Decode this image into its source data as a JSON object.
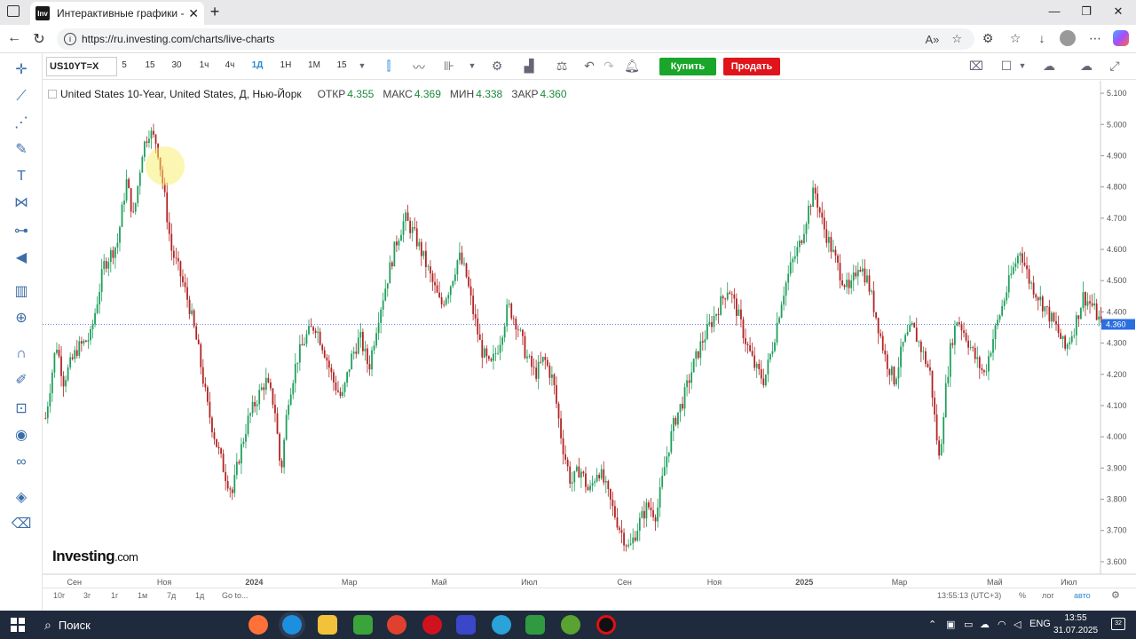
{
  "browser": {
    "tab_title": "Интерактивные графики - Invest",
    "tab_favicon": "Inv",
    "url": "https://ru.investing.com/charts/live-charts"
  },
  "toolbar": {
    "symbol": "US10YT=X",
    "timeframes": [
      "5",
      "15",
      "30",
      "1ч",
      "4ч",
      "1Д",
      "1Н",
      "1М",
      "15"
    ],
    "active_timeframe": "1Д",
    "buy_label": "Купить",
    "sell_label": "Продать"
  },
  "legend": {
    "name": "United States 10-Year, United States, Д, Нью-Йорк",
    "open_label": "ОТКР",
    "open": "4.355",
    "high_label": "МАКС",
    "high": "4.369",
    "low_label": "МИН",
    "low": "4.338",
    "close_label": "ЗАКР",
    "close": "4.360",
    "value_color": "#1b8b3a"
  },
  "chart_data": {
    "type": "candlestick",
    "y_ticks": [
      "5.100",
      "5.000",
      "4.900",
      "4.800",
      "4.700",
      "4.600",
      "4.500",
      "4.400",
      "4.300",
      "4.200",
      "4.100",
      "4.000",
      "3.900",
      "3.800",
      "3.700",
      "3.600"
    ],
    "ylim": [
      3.56,
      5.14
    ],
    "x_ticks": [
      "Сен",
      "Ноя",
      "2024",
      "Мар",
      "Май",
      "Июл",
      "Сен",
      "Ноя",
      "2025",
      "Мар",
      "Май",
      "Июл"
    ],
    "x_tick_values": [
      0.03,
      0.115,
      0.2,
      0.29,
      0.375,
      0.46,
      0.55,
      0.635,
      0.72,
      0.81,
      0.9,
      0.97
    ],
    "last_price": "4.360",
    "last_price_value": 4.36,
    "up_color": "#1e9e5a",
    "down_color": "#b22222",
    "path": [
      [
        0.0,
        4.06
      ],
      [
        0.012,
        4.3
      ],
      [
        0.02,
        4.18
      ],
      [
        0.035,
        4.28
      ],
      [
        0.05,
        4.32
      ],
      [
        0.065,
        4.55
      ],
      [
        0.08,
        4.62
      ],
      [
        0.09,
        4.82
      ],
      [
        0.098,
        4.7
      ],
      [
        0.108,
        4.92
      ],
      [
        0.115,
        4.98
      ],
      [
        0.124,
        4.94
      ],
      [
        0.132,
        4.78
      ],
      [
        0.14,
        4.6
      ],
      [
        0.15,
        4.52
      ],
      [
        0.16,
        4.42
      ],
      [
        0.17,
        4.28
      ],
      [
        0.18,
        4.1
      ],
      [
        0.19,
        3.98
      ],
      [
        0.2,
        3.88
      ],
      [
        0.208,
        3.82
      ],
      [
        0.215,
        3.93
      ],
      [
        0.225,
        4.05
      ],
      [
        0.235,
        4.12
      ],
      [
        0.245,
        4.18
      ],
      [
        0.255,
        4.1
      ],
      [
        0.262,
        3.88
      ],
      [
        0.27,
        4.12
      ],
      [
        0.28,
        4.25
      ],
      [
        0.29,
        4.32
      ],
      [
        0.3,
        4.36
      ],
      [
        0.31,
        4.28
      ],
      [
        0.32,
        4.18
      ],
      [
        0.33,
        4.12
      ],
      [
        0.34,
        4.25
      ],
      [
        0.35,
        4.32
      ],
      [
        0.36,
        4.22
      ],
      [
        0.37,
        4.38
      ],
      [
        0.38,
        4.5
      ],
      [
        0.39,
        4.62
      ],
      [
        0.4,
        4.7
      ],
      [
        0.41,
        4.65
      ],
      [
        0.42,
        4.58
      ],
      [
        0.43,
        4.5
      ],
      [
        0.44,
        4.42
      ],
      [
        0.45,
        4.48
      ],
      [
        0.46,
        4.58
      ],
      [
        0.468,
        4.52
      ],
      [
        0.476,
        4.4
      ],
      [
        0.485,
        4.28
      ],
      [
        0.495,
        4.22
      ],
      [
        0.505,
        4.3
      ],
      [
        0.515,
        4.42
      ],
      [
        0.525,
        4.36
      ],
      [
        0.535,
        4.26
      ],
      [
        0.545,
        4.2
      ],
      [
        0.555,
        4.25
      ],
      [
        0.565,
        4.18
      ],
      [
        0.575,
        3.98
      ],
      [
        0.585,
        3.85
      ],
      [
        0.595,
        3.9
      ],
      [
        0.605,
        3.82
      ],
      [
        0.615,
        3.9
      ],
      [
        0.622,
        3.85
      ],
      [
        0.63,
        3.78
      ],
      [
        0.64,
        3.7
      ],
      [
        0.65,
        3.64
      ],
      [
        0.66,
        3.72
      ],
      [
        0.67,
        3.78
      ],
      [
        0.68,
        3.75
      ],
      [
        0.69,
        3.92
      ],
      [
        0.7,
        4.05
      ],
      [
        0.71,
        4.12
      ],
      [
        0.72,
        4.22
      ],
      [
        0.73,
        4.3
      ],
      [
        0.74,
        4.36
      ],
      [
        0.75,
        4.42
      ],
      [
        0.76,
        4.48
      ],
      [
        0.77,
        4.4
      ],
      [
        0.78,
        4.3
      ],
      [
        0.79,
        4.22
      ],
      [
        0.8,
        4.18
      ],
      [
        0.81,
        4.3
      ],
      [
        0.82,
        4.45
      ],
      [
        0.83,
        4.55
      ],
      [
        0.84,
        4.62
      ],
      [
        0.85,
        4.74
      ],
      [
        0.856,
        4.79
      ],
      [
        0.865,
        4.68
      ],
      [
        0.875,
        4.6
      ],
      [
        0.885,
        4.52
      ],
      [
        0.895,
        4.46
      ],
      [
        0.905,
        4.56
      ],
      [
        0.915,
        4.5
      ],
      [
        0.925,
        4.38
      ],
      [
        0.935,
        4.25
      ],
      [
        0.945,
        4.18
      ],
      [
        0.955,
        4.3
      ],
      [
        0.965,
        4.35
      ],
      [
        0.975,
        4.28
      ],
      [
        0.985,
        4.2
      ],
      [
        0.99,
        4.05
      ],
      [
        0.995,
        3.92
      ],
      [
        1.0,
        4.1
      ],
      [
        1.008,
        4.3
      ],
      [
        1.015,
        4.38
      ],
      [
        1.025,
        4.32
      ],
      [
        1.035,
        4.25
      ],
      [
        1.045,
        4.2
      ],
      [
        1.055,
        4.32
      ],
      [
        1.065,
        4.42
      ],
      [
        1.075,
        4.52
      ],
      [
        1.085,
        4.6
      ],
      [
        1.095,
        4.5
      ],
      [
        1.105,
        4.45
      ],
      [
        1.115,
        4.4
      ],
      [
        1.125,
        4.35
      ],
      [
        1.135,
        4.28
      ],
      [
        1.145,
        4.35
      ],
      [
        1.155,
        4.45
      ],
      [
        1.165,
        4.42
      ],
      [
        1.175,
        4.36
      ]
    ]
  },
  "watermark": {
    "brand": "Investing",
    "suffix": ".com"
  },
  "bottom": {
    "ranges": [
      "10г",
      "3г",
      "1г",
      "1м",
      "7д",
      "1д"
    ],
    "goto": "Go to...",
    "time": "13:55:13 (UTC+3)",
    "percent": "%",
    "log": "лог",
    "auto": "авто"
  },
  "taskbar": {
    "search": "Поиск",
    "lang": "ENG",
    "time": "13:55",
    "date": "31.07.2025",
    "notifications": "32"
  },
  "icons": {
    "left_tools": [
      "crosshair-icon",
      "trend-line-icon",
      "fib-icon",
      "brush-icon",
      "text-icon",
      "pattern-icon",
      "measure-icon",
      "back-arrow-icon",
      "indicators-icon",
      "zoom-icon",
      "magnet-icon",
      "pencil-lock-icon",
      "lock-icon",
      "eye-icon",
      "link-icon",
      "layers-icon",
      "trash-icon"
    ]
  }
}
